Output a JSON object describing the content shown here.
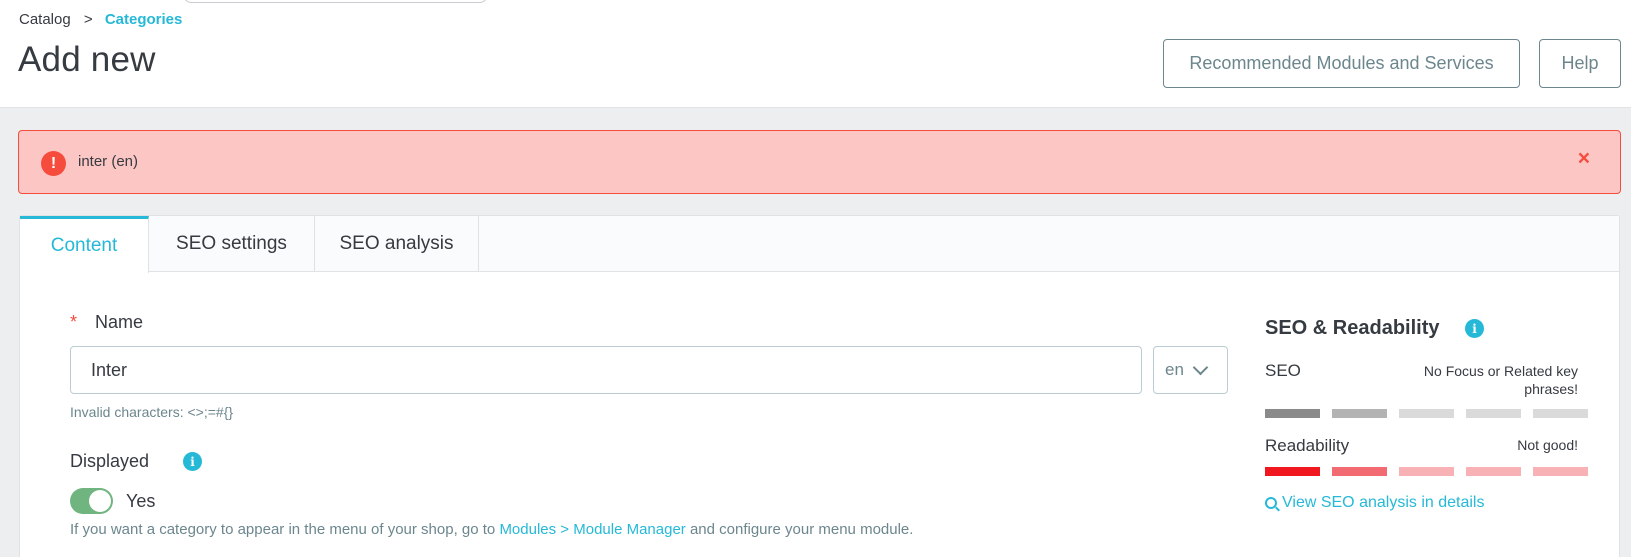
{
  "breadcrumb": {
    "parent": "Catalog",
    "separator": ">",
    "current": "Categories"
  },
  "page": {
    "title": "Add new"
  },
  "toolbar": {
    "recommended_label": "Recommended Modules and Services",
    "help_label": "Help"
  },
  "alert": {
    "icon": "exclamation-icon",
    "message": "inter (en)",
    "close": "×"
  },
  "tabs": [
    {
      "label": "Content",
      "active": true
    },
    {
      "label": "SEO settings",
      "active": false
    },
    {
      "label": "SEO analysis",
      "active": false
    }
  ],
  "form": {
    "name": {
      "required_mark": "*",
      "label": "Name",
      "value": "Inter",
      "language": "en",
      "hint": "Invalid characters: <>;=#{}"
    },
    "displayed": {
      "label": "Displayed",
      "info_icon": "i",
      "toggle_on": true,
      "toggle_label": "Yes",
      "help_before": "If you want a category to appear in the menu of your shop, go to ",
      "help_link": "Modules > Module Manager",
      "help_after": " and configure your menu module."
    }
  },
  "seo_panel": {
    "title": "SEO & Readability",
    "info_icon": "i",
    "seo_label": "SEO",
    "seo_status": "No Focus or Related key phrases!",
    "seo_bar_colors": [
      "#8a8a8a",
      "#b3b3b3",
      "#dadada",
      "#dadada",
      "#dadada"
    ],
    "readability_label": "Readability",
    "readability_status": "Not good!",
    "readability_bar_colors": [
      "#f0171f",
      "#f36b72",
      "#f8b1b5",
      "#f8b1b5",
      "#f8b1b5"
    ],
    "view_link": "View SEO analysis in details"
  },
  "colors": {
    "accent": "#25b9d7",
    "danger": "#f54c3e",
    "success": "#70b580"
  }
}
